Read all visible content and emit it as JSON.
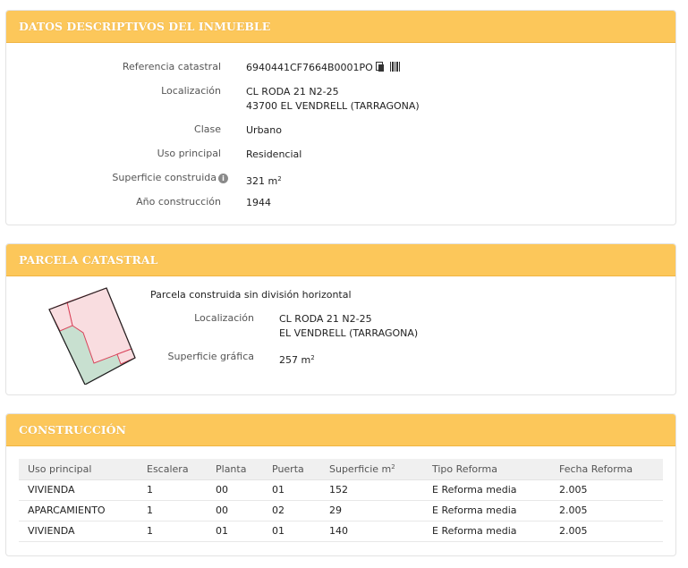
{
  "inmueble": {
    "title": "DATOS DESCRIPTIVOS DEL INMUEBLE",
    "referencia_label": "Referencia catastral",
    "referencia_value": "6940441CF7664B0001PO",
    "localizacion_label": "Localización",
    "localizacion_line1": "CL RODA 21 N2-25",
    "localizacion_line2": "43700 EL VENDRELL (TARRAGONA)",
    "clase_label": "Clase",
    "clase_value": "Urbano",
    "uso_label": "Uso principal",
    "uso_value": "Residencial",
    "superficie_label": "Superficie construida",
    "superficie_value": "321 m",
    "superficie_exp": "2",
    "anio_label": "Año construcción",
    "anio_value": "1944"
  },
  "parcela": {
    "title": "PARCELA CATASTRAL",
    "description": "Parcela construida sin división horizontal",
    "localizacion_label": "Localización",
    "localizacion_line1": "CL RODA 21 N2-25",
    "localizacion_line2": "EL VENDRELL (TARRAGONA)",
    "superficie_label": "Superficie gráfica",
    "superficie_value": "257 m",
    "superficie_exp": "2"
  },
  "construccion": {
    "title": "CONSTRUCCIÓN",
    "headers": {
      "uso": "Uso principal",
      "escalera": "Escalera",
      "planta": "Planta",
      "puerta": "Puerta",
      "superficie": "Superficie m",
      "superficie_exp": "2",
      "tipo": "Tipo Reforma",
      "fecha": "Fecha Reforma"
    },
    "rows": [
      {
        "uso": "VIVIENDA",
        "escalera": "1",
        "planta": "00",
        "puerta": "01",
        "superficie": "152",
        "tipo": "E Reforma media",
        "fecha": "2.005"
      },
      {
        "uso": "APARCAMIENTO",
        "escalera": "1",
        "planta": "00",
        "puerta": "02",
        "superficie": "29",
        "tipo": "E Reforma media",
        "fecha": "2.005"
      },
      {
        "uso": "VIVIENDA",
        "escalera": "1",
        "planta": "01",
        "puerta": "01",
        "superficie": "140",
        "tipo": "E Reforma media",
        "fecha": "2.005"
      }
    ]
  },
  "colors": {
    "header_bg": "#fcc75a",
    "parcel_pink": "#f9dde0",
    "parcel_green": "#c8e0d0",
    "parcel_outline": "#d9435a"
  },
  "icons": [
    "info-icon",
    "copy-icon",
    "barcode-icon"
  ]
}
